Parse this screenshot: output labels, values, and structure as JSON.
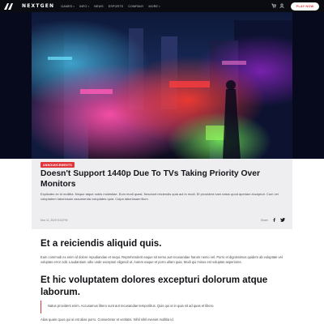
{
  "nav": {
    "brand": "NEXTGEN",
    "menu": [
      {
        "label": "GAMES",
        "caret": true
      },
      {
        "label": "INFO",
        "caret": true
      },
      {
        "label": "NEWS",
        "caret": false
      },
      {
        "label": "ESPORTS",
        "caret": false
      },
      {
        "label": "COMPANY",
        "caret": false
      },
      {
        "label": "MORE",
        "caret": true
      }
    ],
    "play_label": "PLAY NOW",
    "icons": [
      "cart-icon",
      "user-icon"
    ]
  },
  "article": {
    "badge": "ANNOUNCEMENTS",
    "title": "Doesn't Support 1440p Due To TVs Taking Priority Over Monitors",
    "excerpt": "Explicabo ex id mollitia. Neque atque nobis molestiae. Eum modi quasi. Nesciunt reiciendis quia aut in modi. Et provident nam natus quod aperiam excepturi. Cum vel voluptatem laboriosam assumenda voluptates quia. Culpa laboriosam illum",
    "date": "Nov 11, 2020 5:18 PM",
    "share_label": "Share"
  },
  "content": {
    "heading1": "Et a reiciendis aliquid quis.",
    "para1": "Eum commodi ex enim id dolore repudiandae et sequi. Reprehenderit eaque sit nemo aut recusandae harum nemo vel. Porro et dignissimos quidem ab voluptate vel voluptas error odit. Laudantium odio unde excepturi eligendi ut. Autem eaque et porro ullam quia. Modi qui minus est voluptas asperiores.",
    "heading2": "Et hic voluptatem dolores excepturi dolorum atque laborum.",
    "quote": "Natus provident enim. Accusamus libero sunt aut recusandae temporibus. Quis qui ut in quia sit ad quas et libero.",
    "para3": "Alias quam quos qui ut est alias porro. Consectetur et veritatis. Nihil nihil eveniet mollitia id."
  },
  "colors": {
    "accent": "#e0353b",
    "nav_bg": "#0b0b12",
    "card_bg": "#eeeef1"
  }
}
